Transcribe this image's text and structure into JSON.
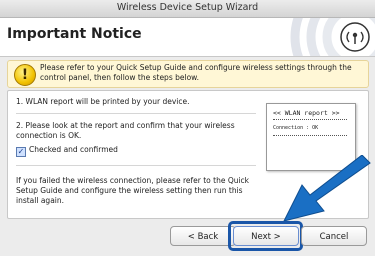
{
  "window": {
    "title": "Wireless Device Setup Wizard"
  },
  "header": {
    "heading": "Important Notice"
  },
  "notice": {
    "icon": "warning-icon",
    "text": "Please refer to your Quick Setup Guide and configure wireless settings through the control panel, then follow the steps below."
  },
  "steps": {
    "step1": "1. WLAN report will be printed by your device.",
    "step2": "2. Please look at the report and confirm that your wireless connection is OK.",
    "checkbox_label": "Checked and confirmed",
    "checkbox_checked": true,
    "failed_note": "If you failed the wireless connection, please refer to the Quick Setup Guide and configure the wireless setting then run this install again."
  },
  "report": {
    "title": "<< WLAN report >>",
    "row": "Connection : OK"
  },
  "buttons": {
    "back": "< Back",
    "next": "Next >",
    "cancel": "Cancel"
  },
  "colors": {
    "accent": "#1a56a8",
    "notice_bg": "#fff7d6"
  }
}
